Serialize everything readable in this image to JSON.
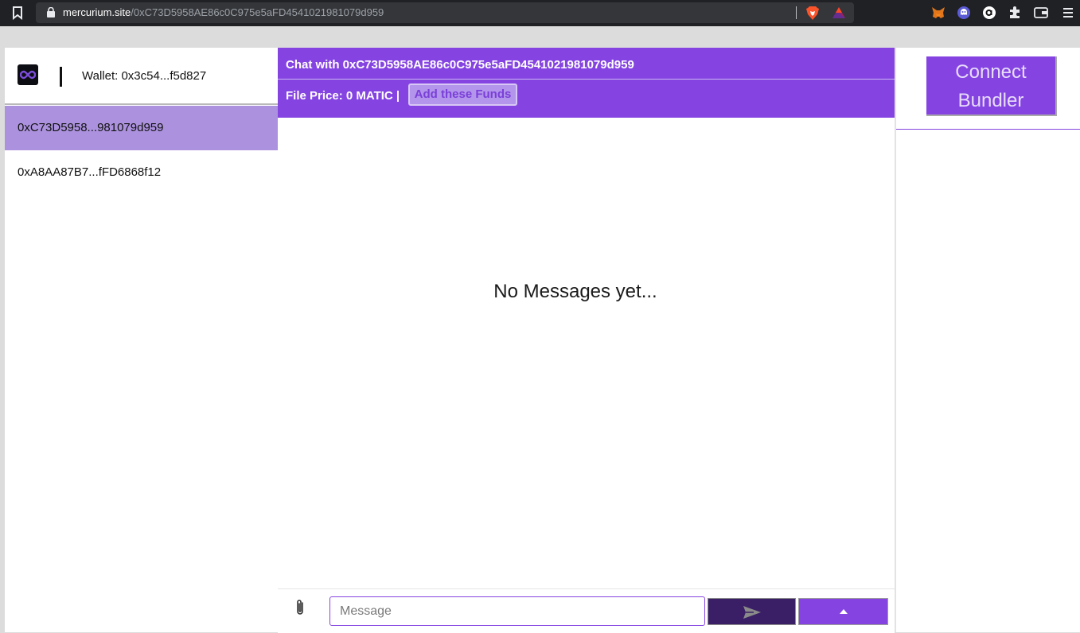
{
  "browser": {
    "url_domain": "mercurium.site",
    "url_path": "/0xC73D5958AE86c0C975e5aFD4541021981079d959",
    "icons": [
      "bookmark-icon",
      "lock-icon",
      "brave-shield-icon",
      "brave-rewards-icon",
      "metamask-icon",
      "ghost-ext-icon",
      "amazon-icon",
      "extensions-puzzle-icon",
      "wallet-icon",
      "menu-icon"
    ]
  },
  "sidebar": {
    "wallet_label": "Wallet: 0x3c54...f5d827",
    "contacts": [
      {
        "address": "0xC73D5958...981079d959",
        "active": true
      },
      {
        "address": "0xA8AA87B7...fFD6868f12",
        "active": false
      }
    ]
  },
  "chat": {
    "title": "Chat with 0xC73D5958AE86c0C975e5aFD4541021981079d959",
    "price_text": "File Price: 0 MATIC |",
    "add_funds_label": "Add these Funds",
    "empty_state": "No Messages yet...",
    "message_placeholder": "Message"
  },
  "right_panel": {
    "connect_label": "Connect Bundler"
  },
  "colors": {
    "accent": "#8544e2",
    "selected_row": "#ac92de",
    "send_button": "#3a1f66"
  }
}
